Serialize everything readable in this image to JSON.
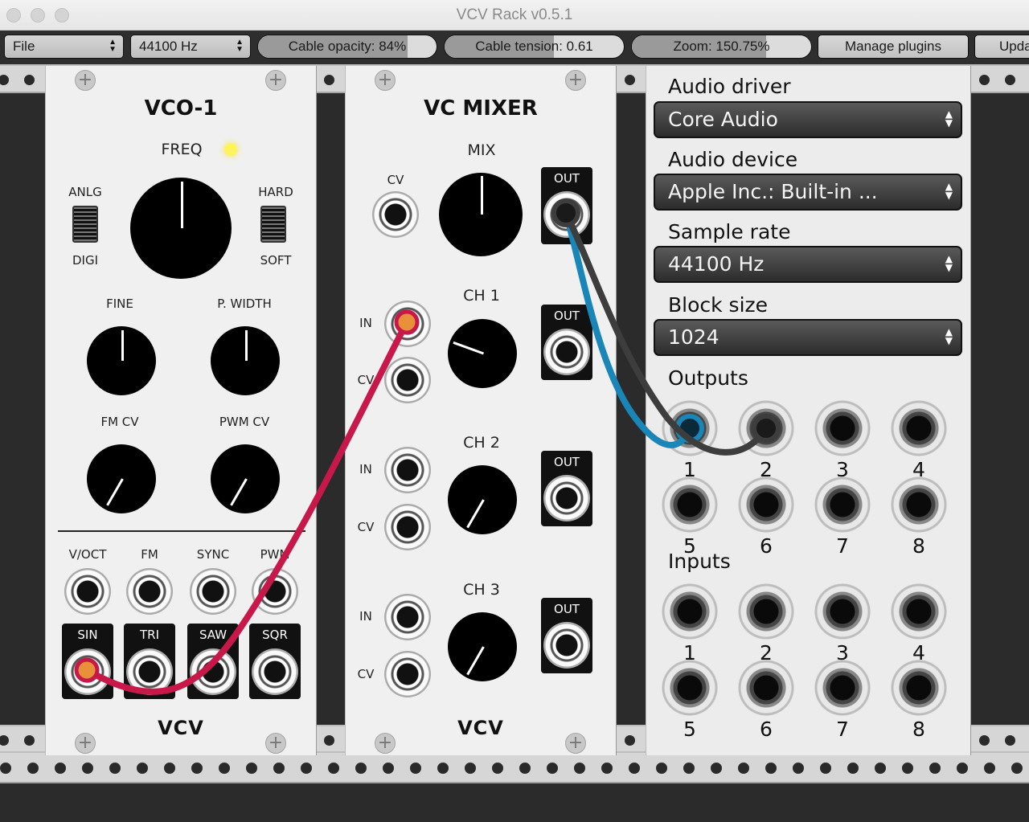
{
  "window": {
    "title": "VCV Rack v0.5.1"
  },
  "toolbar": {
    "file_label": "File",
    "sample_rate": "44100 Hz",
    "cable_opacity": {
      "label": "Cable opacity: 84%",
      "value": 0.84
    },
    "cable_tension": {
      "label": "Cable tension: 0.61",
      "value": 0.61
    },
    "zoom": {
      "label": "Zoom: 150.75%",
      "value": 0.75
    },
    "manage_plugins": "Manage plugins",
    "update": "Upda"
  },
  "vco": {
    "title": "VCO-1",
    "freq": "FREQ",
    "anlg": "ANLG",
    "digi": "DIGI",
    "hard": "HARD",
    "soft": "SOFT",
    "fine": "FINE",
    "pwidth": "P. WIDTH",
    "fmcv": "FM CV",
    "pwmcv": "PWM CV",
    "voct": "V/OCT",
    "fm": "FM",
    "sync": "SYNC",
    "pwm": "PWM",
    "sin": "SIN",
    "tri": "TRI",
    "saw": "SAW",
    "sqr": "SQR",
    "logo": "VCV"
  },
  "mixer": {
    "title": "VC MIXER",
    "mix": "MIX",
    "cv": "CV",
    "out": "OUT",
    "ch1": "CH 1",
    "ch2": "CH 2",
    "ch3": "CH 3",
    "in": "IN",
    "logo": "VCV"
  },
  "audio": {
    "driver_label": "Audio driver",
    "driver_value": "Core Audio",
    "device_label": "Audio device",
    "device_value": "Apple Inc.: Built-in ...",
    "rate_label": "Sample rate",
    "rate_value": "44100 Hz",
    "block_label": "Block size",
    "block_value": "1024",
    "outputs_label": "Outputs",
    "inputs_label": "Inputs",
    "outputs": [
      "1",
      "2",
      "3",
      "4",
      "5",
      "6",
      "7",
      "8"
    ],
    "inputs": [
      "1",
      "2",
      "3",
      "4",
      "5",
      "6",
      "7",
      "8"
    ]
  },
  "colors": {
    "red_cable": "#c8184a",
    "blue_cable": "#1a86b8",
    "grey_cable": "#3d3d3d",
    "led": "#fff35a",
    "connector_orange": "#e8913a"
  }
}
